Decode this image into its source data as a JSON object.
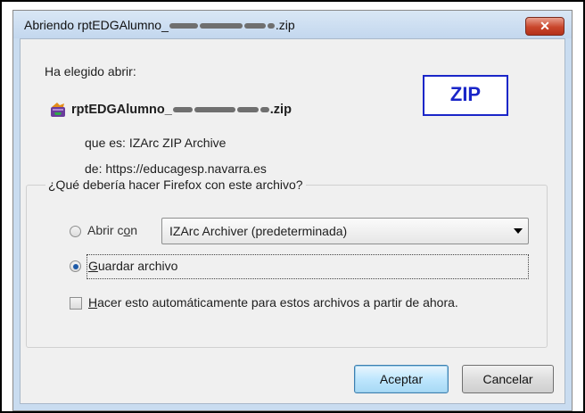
{
  "window": {
    "title_prefix": "Abriendo rptEDGAlumno_",
    "title_suffix": ".zip",
    "close_symbol": "✕"
  },
  "dialog": {
    "intro": "Ha elegido abrir:",
    "file_prefix": "rptEDGAlumno_",
    "file_suffix": ".zip",
    "file_icon": "izarc-archive-icon",
    "type_line": "que es: IZArc ZIP Archive",
    "source_line": "de: https://educagesp.navarra.es",
    "badge": "ZIP",
    "question": "¿Qué debería hacer Firefox con este archivo?"
  },
  "options": {
    "open_with": {
      "label_pre": "Abrir c",
      "label_accel": "o",
      "label_post": "n",
      "checked": false
    },
    "app_select": {
      "value": "IZArc Archiver (predeterminada)"
    },
    "save_file": {
      "label_pre": "",
      "label_accel": "G",
      "label_post": "uardar archivo",
      "checked": true
    },
    "auto": {
      "label_pre": "",
      "label_accel": "H",
      "label_post": "acer esto automáticamente para estos archivos a partir de ahora.",
      "checked": false
    }
  },
  "buttons": {
    "accept": "Aceptar",
    "cancel": "Cancelar"
  },
  "colors": {
    "badge": "#1a26c8",
    "close_button": "#c9462b"
  }
}
